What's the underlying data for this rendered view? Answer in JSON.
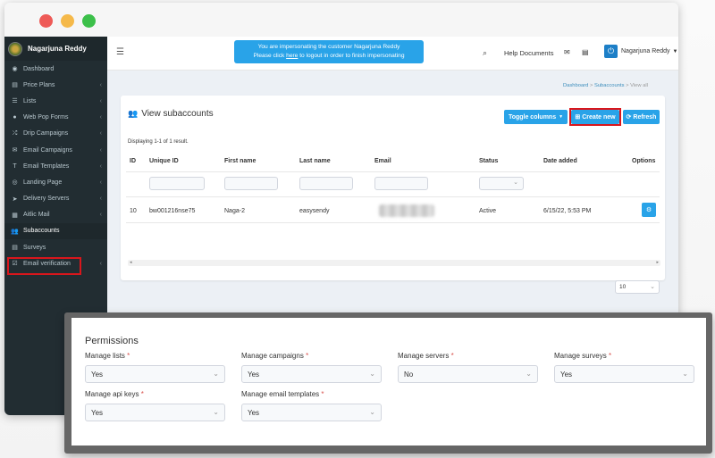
{
  "app": {
    "user_name": "Nagarjuna Reddy"
  },
  "sidebar": {
    "items": [
      {
        "label": "Dashboard",
        "icon": "dashboard-icon",
        "glyph": "◉",
        "chevron": ""
      },
      {
        "label": "Price Plans",
        "icon": "credit-card-icon",
        "glyph": "▤",
        "chevron": "‹"
      },
      {
        "label": "Lists",
        "icon": "list-icon",
        "glyph": "☰",
        "chevron": "‹"
      },
      {
        "label": "Web Pop Forms",
        "icon": "globe-icon",
        "glyph": "●",
        "chevron": "‹"
      },
      {
        "label": "Drip Campaigns",
        "icon": "random-icon",
        "glyph": "⤮",
        "chevron": "‹"
      },
      {
        "label": "Email Campaigns",
        "icon": "envelope-icon",
        "glyph": "✉",
        "chevron": "‹"
      },
      {
        "label": "Email Templates",
        "icon": "text-icon",
        "glyph": "T",
        "chevron": "‹"
      },
      {
        "label": "Landing Page",
        "icon": "compass-icon",
        "glyph": "◎",
        "chevron": "‹"
      },
      {
        "label": "Delivery Servers",
        "icon": "send-icon",
        "glyph": "➤",
        "chevron": "‹"
      },
      {
        "label": "Aitlic Mail",
        "icon": "grid-icon",
        "glyph": "▦",
        "chevron": "‹"
      },
      {
        "label": "Subaccounts",
        "icon": "users-icon",
        "glyph": "👥",
        "chevron": ""
      },
      {
        "label": "Surveys",
        "icon": "list-alt-icon",
        "glyph": "▤",
        "chevron": ""
      },
      {
        "label": "Email verification",
        "icon": "check-square-icon",
        "glyph": "☑",
        "chevron": "‹"
      }
    ]
  },
  "topbar": {
    "impersonate_line1": "You are impersonating the customer Nagarjuna Reddy",
    "impersonate_line2_pre": "Please click ",
    "impersonate_link": "here",
    "impersonate_line2_post": " to logout in order to finish impersonating",
    "help": "Help Documents",
    "user": "Nagarjuna Reddy"
  },
  "breadcrumb": {
    "items": [
      "Dashboard",
      "Subaccounts"
    ],
    "current": "View all",
    "sep": " > "
  },
  "panel": {
    "title": "View subaccounts",
    "toggle_btn": "Toggle columns",
    "create_btn": "Create new",
    "refresh_btn": "Refresh",
    "display_text": "Displaying 1-1 of 1 result.",
    "columns": [
      "ID",
      "Unique ID",
      "First name",
      "Last name",
      "Email",
      "Status",
      "Date added",
      "Options"
    ],
    "rows": [
      {
        "id": "10",
        "unique_id": "bw001216nse75",
        "first_name": "Naga-2",
        "last_name": "easysendy",
        "email": "",
        "status": "Active",
        "date_added": "6/15/22, 5:53 PM"
      }
    ],
    "page_size": "10"
  },
  "permissions": {
    "title": "Permissions",
    "fields": [
      {
        "label": "Manage lists",
        "value": "Yes"
      },
      {
        "label": "Manage campaigns",
        "value": "Yes"
      },
      {
        "label": "Manage servers",
        "value": "No"
      },
      {
        "label": "Manage surveys",
        "value": "Yes"
      },
      {
        "label": "Manage api keys",
        "value": "Yes"
      },
      {
        "label": "Manage email templates",
        "value": "Yes"
      }
    ]
  },
  "colors": {
    "accent": "#29a3e8",
    "sidebar": "#222d32",
    "highlight": "#d9161c"
  }
}
